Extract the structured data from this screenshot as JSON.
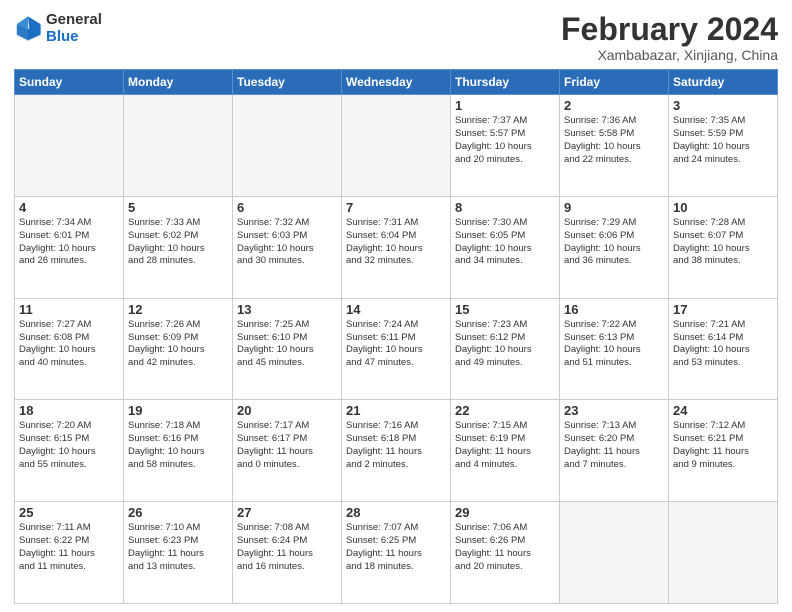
{
  "logo": {
    "general": "General",
    "blue": "Blue"
  },
  "title": "February 2024",
  "location": "Xambabazar, Xinjiang, China",
  "weekdays": [
    "Sunday",
    "Monday",
    "Tuesday",
    "Wednesday",
    "Thursday",
    "Friday",
    "Saturday"
  ],
  "weeks": [
    [
      {
        "day": "",
        "info": ""
      },
      {
        "day": "",
        "info": ""
      },
      {
        "day": "",
        "info": ""
      },
      {
        "day": "",
        "info": ""
      },
      {
        "day": "1",
        "info": "Sunrise: 7:37 AM\nSunset: 5:57 PM\nDaylight: 10 hours\nand 20 minutes."
      },
      {
        "day": "2",
        "info": "Sunrise: 7:36 AM\nSunset: 5:58 PM\nDaylight: 10 hours\nand 22 minutes."
      },
      {
        "day": "3",
        "info": "Sunrise: 7:35 AM\nSunset: 5:59 PM\nDaylight: 10 hours\nand 24 minutes."
      }
    ],
    [
      {
        "day": "4",
        "info": "Sunrise: 7:34 AM\nSunset: 6:01 PM\nDaylight: 10 hours\nand 26 minutes."
      },
      {
        "day": "5",
        "info": "Sunrise: 7:33 AM\nSunset: 6:02 PM\nDaylight: 10 hours\nand 28 minutes."
      },
      {
        "day": "6",
        "info": "Sunrise: 7:32 AM\nSunset: 6:03 PM\nDaylight: 10 hours\nand 30 minutes."
      },
      {
        "day": "7",
        "info": "Sunrise: 7:31 AM\nSunset: 6:04 PM\nDaylight: 10 hours\nand 32 minutes."
      },
      {
        "day": "8",
        "info": "Sunrise: 7:30 AM\nSunset: 6:05 PM\nDaylight: 10 hours\nand 34 minutes."
      },
      {
        "day": "9",
        "info": "Sunrise: 7:29 AM\nSunset: 6:06 PM\nDaylight: 10 hours\nand 36 minutes."
      },
      {
        "day": "10",
        "info": "Sunrise: 7:28 AM\nSunset: 6:07 PM\nDaylight: 10 hours\nand 38 minutes."
      }
    ],
    [
      {
        "day": "11",
        "info": "Sunrise: 7:27 AM\nSunset: 6:08 PM\nDaylight: 10 hours\nand 40 minutes."
      },
      {
        "day": "12",
        "info": "Sunrise: 7:26 AM\nSunset: 6:09 PM\nDaylight: 10 hours\nand 42 minutes."
      },
      {
        "day": "13",
        "info": "Sunrise: 7:25 AM\nSunset: 6:10 PM\nDaylight: 10 hours\nand 45 minutes."
      },
      {
        "day": "14",
        "info": "Sunrise: 7:24 AM\nSunset: 6:11 PM\nDaylight: 10 hours\nand 47 minutes."
      },
      {
        "day": "15",
        "info": "Sunrise: 7:23 AM\nSunset: 6:12 PM\nDaylight: 10 hours\nand 49 minutes."
      },
      {
        "day": "16",
        "info": "Sunrise: 7:22 AM\nSunset: 6:13 PM\nDaylight: 10 hours\nand 51 minutes."
      },
      {
        "day": "17",
        "info": "Sunrise: 7:21 AM\nSunset: 6:14 PM\nDaylight: 10 hours\nand 53 minutes."
      }
    ],
    [
      {
        "day": "18",
        "info": "Sunrise: 7:20 AM\nSunset: 6:15 PM\nDaylight: 10 hours\nand 55 minutes."
      },
      {
        "day": "19",
        "info": "Sunrise: 7:18 AM\nSunset: 6:16 PM\nDaylight: 10 hours\nand 58 minutes."
      },
      {
        "day": "20",
        "info": "Sunrise: 7:17 AM\nSunset: 6:17 PM\nDaylight: 11 hours\nand 0 minutes."
      },
      {
        "day": "21",
        "info": "Sunrise: 7:16 AM\nSunset: 6:18 PM\nDaylight: 11 hours\nand 2 minutes."
      },
      {
        "day": "22",
        "info": "Sunrise: 7:15 AM\nSunset: 6:19 PM\nDaylight: 11 hours\nand 4 minutes."
      },
      {
        "day": "23",
        "info": "Sunrise: 7:13 AM\nSunset: 6:20 PM\nDaylight: 11 hours\nand 7 minutes."
      },
      {
        "day": "24",
        "info": "Sunrise: 7:12 AM\nSunset: 6:21 PM\nDaylight: 11 hours\nand 9 minutes."
      }
    ],
    [
      {
        "day": "25",
        "info": "Sunrise: 7:11 AM\nSunset: 6:22 PM\nDaylight: 11 hours\nand 11 minutes."
      },
      {
        "day": "26",
        "info": "Sunrise: 7:10 AM\nSunset: 6:23 PM\nDaylight: 11 hours\nand 13 minutes."
      },
      {
        "day": "27",
        "info": "Sunrise: 7:08 AM\nSunset: 6:24 PM\nDaylight: 11 hours\nand 16 minutes."
      },
      {
        "day": "28",
        "info": "Sunrise: 7:07 AM\nSunset: 6:25 PM\nDaylight: 11 hours\nand 18 minutes."
      },
      {
        "day": "29",
        "info": "Sunrise: 7:06 AM\nSunset: 6:26 PM\nDaylight: 11 hours\nand 20 minutes."
      },
      {
        "day": "",
        "info": ""
      },
      {
        "day": "",
        "info": ""
      }
    ]
  ]
}
